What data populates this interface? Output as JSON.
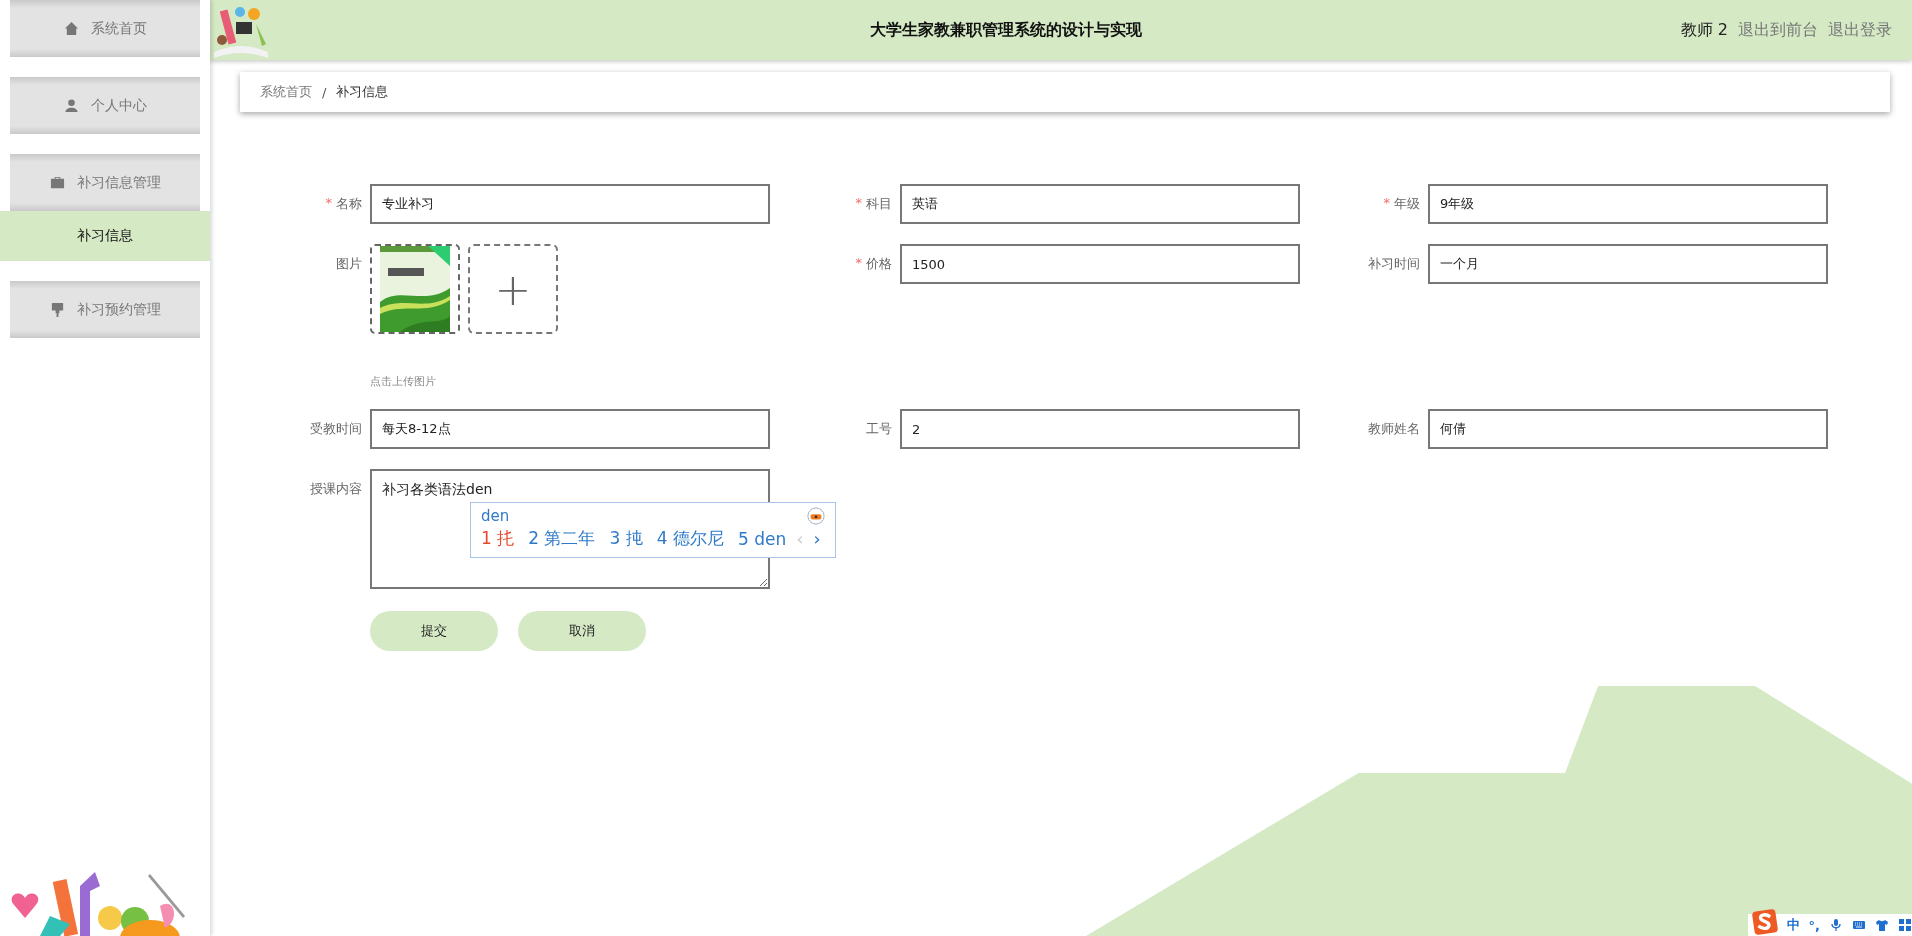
{
  "sidebar": {
    "items": [
      {
        "kind": "item",
        "label": "系统首页",
        "selected": false
      },
      {
        "kind": "item",
        "label": "个人中心",
        "selected": false
      },
      {
        "kind": "group",
        "label": "补习信息管理",
        "selected": false,
        "children": [
          {
            "label": "补习信息",
            "selected": true
          }
        ]
      },
      {
        "kind": "group",
        "label": "补习预约管理",
        "selected": false
      }
    ]
  },
  "header": {
    "title": "大学生家教兼职管理系统的设计与实现",
    "user": "教师 2",
    "links": [
      "退出到前台",
      "退出登录"
    ]
  },
  "breadcrumb": [
    "系统首页",
    "补习信息"
  ],
  "breadcrumb_separator": "/",
  "form": {
    "rows": [
      [
        {
          "kind": "text",
          "label": "名称",
          "required_mark": "*",
          "value": "专业补习"
        },
        {
          "kind": "text",
          "label": "科目",
          "required_mark": "*",
          "value": "英语"
        },
        {
          "kind": "text",
          "label": "年级",
          "required_mark": "*",
          "value": "9年级"
        }
      ],
      [
        {
          "kind": "upload",
          "label": "图片",
          "hint": "点击上传图片",
          "plus": "+"
        },
        {
          "kind": "text",
          "label": "价格",
          "required_mark": "*",
          "value": "1500"
        },
        {
          "kind": "text",
          "label": "补习时间",
          "value": "一个月"
        }
      ],
      [
        {
          "kind": "text",
          "label": "受教时间",
          "value": "每天8-12点"
        },
        {
          "kind": "text",
          "label": "工号",
          "value": "2"
        },
        {
          "kind": "text",
          "label": "教师姓名",
          "value": "何倩"
        }
      ],
      [
        {
          "kind": "textarea",
          "label": "授课内容",
          "value": "补习各类语法den"
        }
      ]
    ],
    "buttons": [
      "提交",
      "取消"
    ]
  },
  "ime_popup": {
    "composition": "den",
    "candidates": [
      {
        "index": "1",
        "text": "扥",
        "selected": true
      },
      {
        "index": "2",
        "text": "第二年",
        "selected": false
      },
      {
        "index": "3",
        "text": "扽",
        "selected": false
      },
      {
        "index": "4",
        "text": "德尔尼",
        "selected": false
      },
      {
        "index": "5",
        "text": "den",
        "selected": false
      }
    ],
    "prev": {
      "label": "‹",
      "disabled": true
    },
    "next": {
      "label": "›",
      "disabled": false
    }
  },
  "ime_toolbar": {
    "mode": "中",
    "punctuation": "°,"
  }
}
